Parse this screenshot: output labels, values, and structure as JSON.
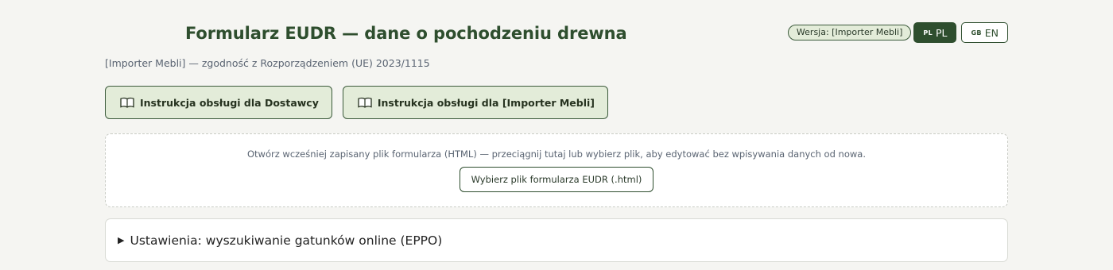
{
  "header": {
    "title": "Formularz EUDR — dane o pochodzeniu drewna",
    "subtitle": "[Importer Mebli] — zgodność z Rozporządzeniem (UE) 2023/1115",
    "version_badge": "Wersja: [Importer Mebli]",
    "languages": [
      {
        "flag": "PL",
        "label": "PL",
        "active": true
      },
      {
        "flag": "GB",
        "label": "EN",
        "active": false
      }
    ]
  },
  "instructions": {
    "supplier_label": "Instrukcja obsługi dla Dostawcy",
    "importer_label": "Instrukcja obsługi dla [Importer Mebli]",
    "icon": "book-icon"
  },
  "dropzone": {
    "text": "Otwórz wcześniej zapisany plik formularza (HTML) — przeciągnij tutaj lub wybierz plik, aby edytować bez wpisywania danych od nowa.",
    "button_label": "Wybierz plik formularza EUDR (.html)"
  },
  "settings": {
    "marker": "▶",
    "label": "Ustawienia: wyszukiwanie gatunków online (EPPO)"
  },
  "colors": {
    "accent": "#2e4e2e",
    "button_bg": "#e3ecd9",
    "page_bg": "#f5f5f2"
  }
}
